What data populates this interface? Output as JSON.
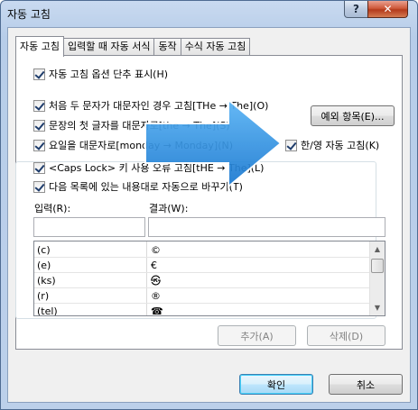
{
  "window": {
    "title": "자동 고침",
    "help_label": "?",
    "close_label": "✕"
  },
  "tabs": [
    {
      "label": "자동 고침",
      "active": true
    },
    {
      "label": "입력할 때 자동 서식",
      "active": false
    },
    {
      "label": "동작",
      "active": false
    },
    {
      "label": "수식 자동 고침",
      "active": false
    }
  ],
  "options": {
    "show_buttons": "자동 고침 옵션 단추 표시(H)",
    "two_initial_caps": "처음 두 문자가 대문자인 경우 고침[THe → The](O)",
    "first_letter_sentence": "문장의 첫 글자를 대문자로[the → The](S)",
    "day_names": "요일을 대문자로[monday → Monday](N)",
    "caps_lock": "<Caps Lock> 키 사용 오류 고침[tHE → The](L)",
    "korean_english": "한/영 자동 고침(K)",
    "replace_as_type": "다음 목록에 있는 내용대로 자동으로 바꾸기(T)"
  },
  "exceptions_button": "예외 항목(E)...",
  "replace": {
    "input_label": "입력(R):",
    "result_label": "결과(W):",
    "input_value": "",
    "result_value": ""
  },
  "entries": [
    {
      "input": "(c)",
      "result": "©"
    },
    {
      "input": "(e)",
      "result": "€"
    },
    {
      "input": "(ks)",
      "result": "㉿"
    },
    {
      "input": "(r)",
      "result": "®"
    },
    {
      "input": "(tel)",
      "result": "☎"
    }
  ],
  "buttons": {
    "add": "추가(A)",
    "delete": "삭제(D)",
    "ok": "확인",
    "cancel": "취소"
  },
  "colors": {
    "arrow": "#1f8fe8",
    "titlebar": "#bcd0ea"
  }
}
